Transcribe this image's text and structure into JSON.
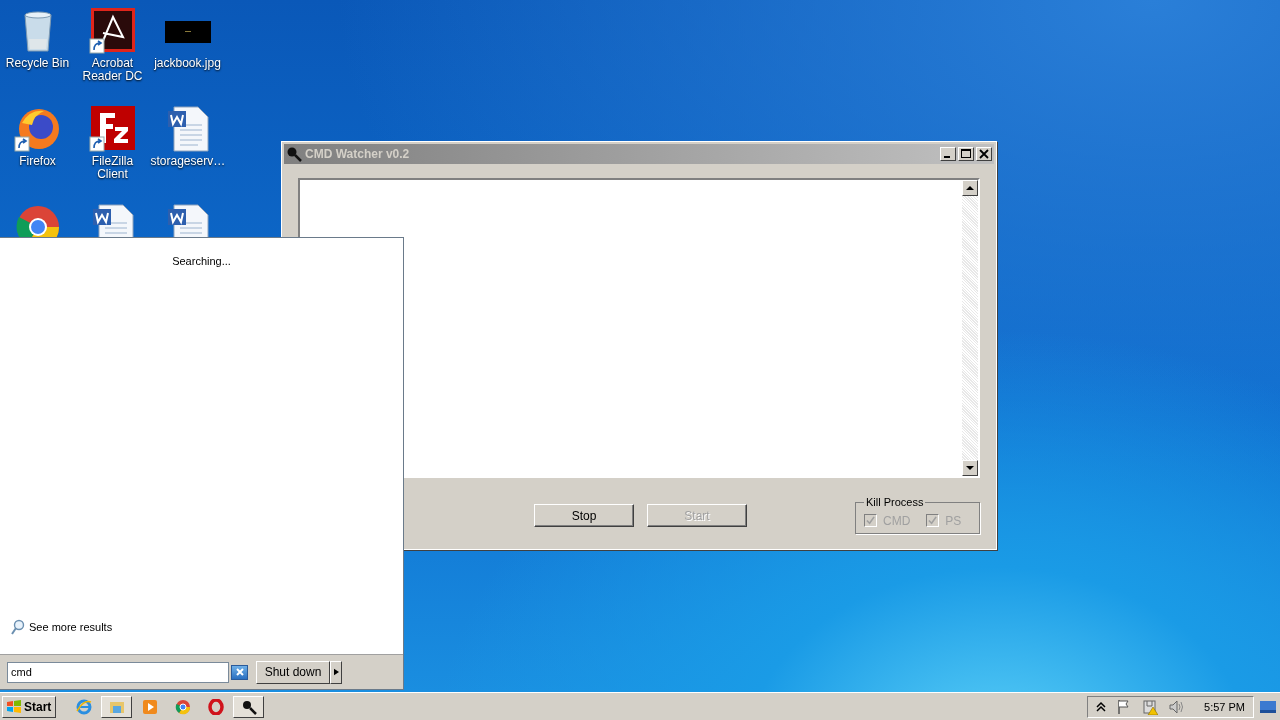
{
  "desktop_icons": [
    {
      "label": "Recycle Bin",
      "kind": "recycle",
      "shortcut": false
    },
    {
      "label": "Acrobat Reader DC",
      "kind": "acrobat",
      "shortcut": true
    },
    {
      "label": "jackbook.jpg",
      "kind": "image",
      "shortcut": false
    },
    {
      "label": "Firefox",
      "kind": "firefox",
      "shortcut": true
    },
    {
      "label": "FileZilla Client",
      "kind": "filezilla",
      "shortcut": true
    },
    {
      "label": "storageserv…",
      "kind": "word",
      "shortcut": false
    },
    {
      "kind": "chrome",
      "shortcut": false
    },
    {
      "kind": "word",
      "shortcut": false
    },
    {
      "kind": "word",
      "shortcut": false
    }
  ],
  "window": {
    "title": "CMD Watcher v0.2",
    "buttons": [
      {
        "label": "Stop",
        "disabled": false
      },
      {
        "label": "Start",
        "disabled": true
      }
    ],
    "kill_process": {
      "label": "Kill Process",
      "options": [
        {
          "label": "CMD",
          "checked": true,
          "disabled": true
        },
        {
          "label": "PS",
          "checked": true,
          "disabled": true
        }
      ]
    }
  },
  "start_menu": {
    "status": "Searching...",
    "see_more": "See more results",
    "search": {
      "value": "cmd"
    },
    "shutdown": "Shut down"
  },
  "taskbar": {
    "start": "Start",
    "apps": [
      {
        "kind": "ie",
        "running": false
      },
      {
        "kind": "explorer",
        "running": true
      },
      {
        "kind": "media",
        "running": false
      },
      {
        "kind": "chrome",
        "running": false
      },
      {
        "kind": "opera",
        "running": false
      },
      {
        "kind": "magnifier",
        "running": true
      }
    ],
    "clock": "5:57 PM"
  }
}
